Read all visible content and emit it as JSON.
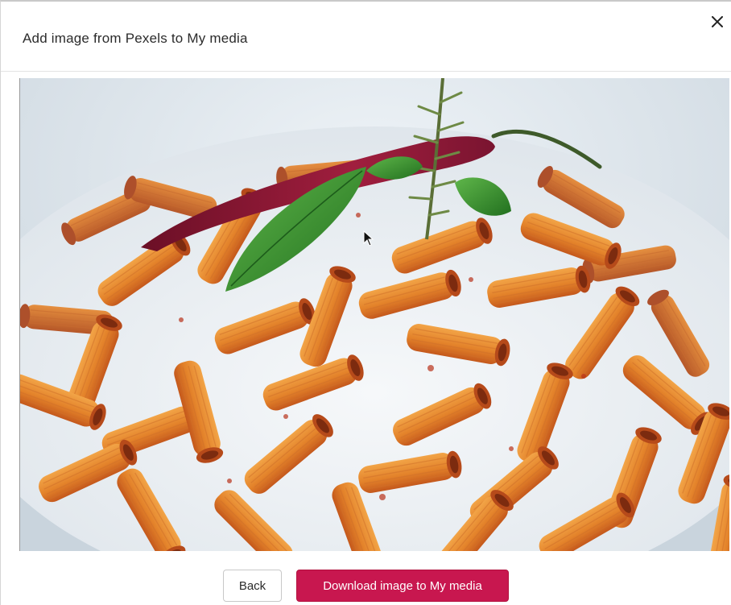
{
  "dialog": {
    "title": "Add image from Pexels to My media",
    "close_icon": "close-icon"
  },
  "preview": {
    "subject": "pasta-photo",
    "colors": {
      "plate": "#eef2f5",
      "background": "#d9e2ea",
      "pasta": "#e88a2e",
      "sauce": "#c9421d",
      "basil": "#2f8a2a",
      "chili": "#8a1634",
      "rosemary": "#5a7a3a"
    }
  },
  "footer": {
    "back_label": "Back",
    "download_label": "Download image to My media"
  },
  "accent_color": "#c8174f"
}
